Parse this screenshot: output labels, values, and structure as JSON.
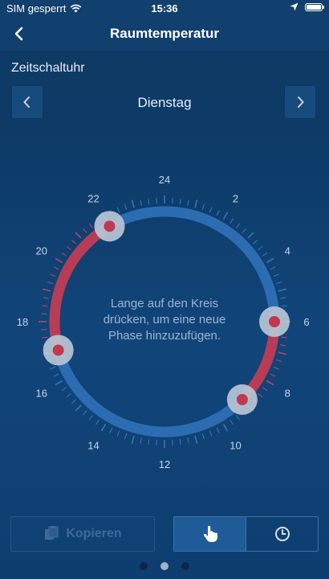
{
  "status_bar": {
    "carrier": "SIM gesperrt",
    "time": "15:36",
    "icons": [
      "wifi-icon",
      "location-icon",
      "battery-icon"
    ]
  },
  "nav": {
    "title": "Raumtemperatur",
    "back_icon": "chevron-left-icon"
  },
  "section": {
    "title": "Zeitschaltuhr"
  },
  "day_selector": {
    "day": "Dienstag",
    "prev_icon": "chevron-left-icon",
    "next_icon": "chevron-right-icon"
  },
  "dial": {
    "hours_total": 24,
    "hour_labels": [
      "24",
      "2",
      "4",
      "6",
      "8",
      "10",
      "12",
      "14",
      "16",
      "18",
      "20",
      "22"
    ],
    "hint_lines": [
      "Lange auf den Kreis",
      "drücken, um eine neue",
      "Phase hinzuzufügen."
    ],
    "phases": [
      {
        "from": 22,
        "to": 6,
        "mode": "low"
      },
      {
        "from": 6,
        "to": 9,
        "mode": "high"
      },
      {
        "from": 9,
        "to": 17,
        "mode": "low"
      },
      {
        "from": 17,
        "to": 22,
        "mode": "high"
      }
    ],
    "handle_hours": [
      22,
      6,
      9,
      17
    ],
    "colors": {
      "low": "#2c6cb2",
      "high": "#b63d55",
      "handle_ring": "#b9c6d6",
      "handle_dot": "#c0394f",
      "tick_low": "#3f7fc1",
      "tick_high": "#c94a63"
    }
  },
  "bottom": {
    "copy_label": "Kopieren",
    "copy_icon": "copy-icon",
    "segments": [
      {
        "icon": "hand-pointer-icon",
        "active": true
      },
      {
        "icon": "clock-icon",
        "active": false
      }
    ]
  },
  "pager": {
    "count": 3,
    "active": 1
  }
}
